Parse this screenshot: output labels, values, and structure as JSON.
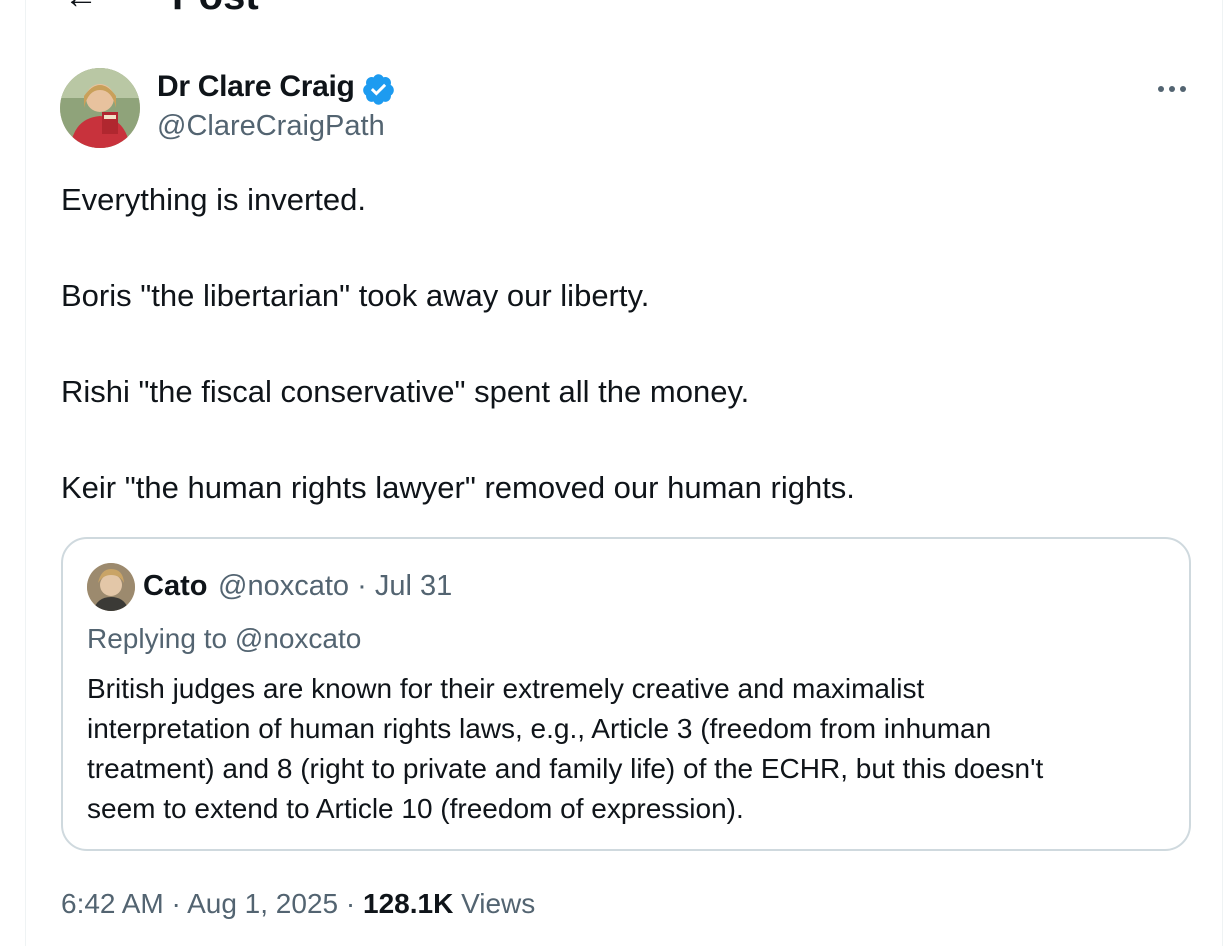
{
  "header": {
    "title": "Post",
    "back_icon": "arrow-left-icon"
  },
  "post": {
    "author": {
      "name": "Dr Clare Craig",
      "handle": "@ClareCraigPath",
      "verified": true,
      "verified_color": "#1d9bf0"
    },
    "text_lines": [
      "Everything is inverted.",
      "Boris \"the libertarian\" took away our liberty.",
      "Rishi \"the fiscal conservative\" spent all the money.",
      "Keir \"the human rights lawyer\" removed our human rights."
    ],
    "quote": {
      "name": "Cato",
      "handle": "@noxcato",
      "separator": "·",
      "date": "Jul 31",
      "replying_to": "Replying to @noxcato",
      "body_lines": [
        "British judges are known for their extremely creative and maximalist",
        "interpretation of human rights laws, e.g., Article 3 (freedom from inhuman",
        "treatment) and 8 (right to private and family life) of the ECHR, but this doesn't",
        "seem to extend to Article 10 (freedom of expression)."
      ]
    },
    "meta": {
      "time": "6:42 AM",
      "sep1": "·",
      "date": "Aug 1, 2025",
      "sep2": "·",
      "views_count": "128.1K",
      "views_label": "Views"
    }
  },
  "colors": {
    "text": "#0f1419",
    "secondary": "#536471",
    "border": "#cfd9de",
    "accent": "#1d9bf0"
  }
}
